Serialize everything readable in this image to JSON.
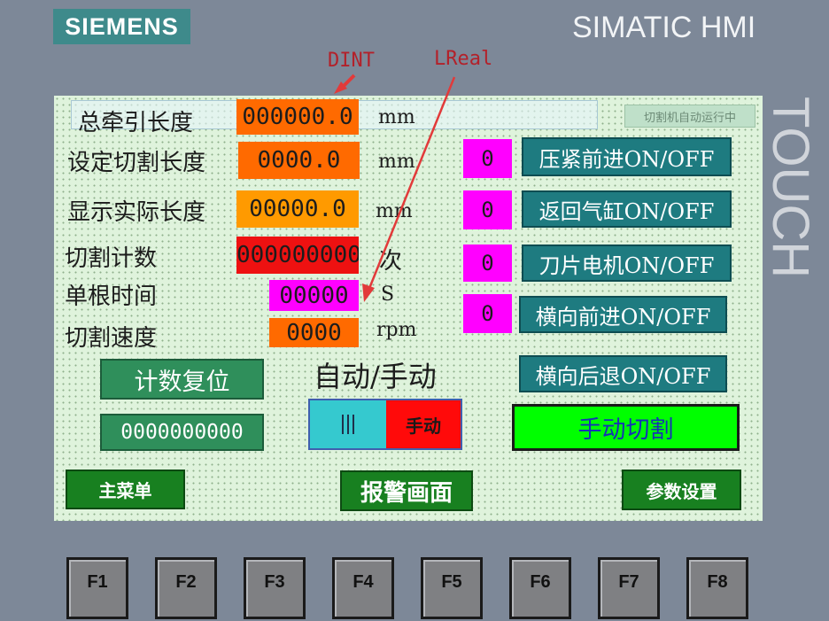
{
  "device": {
    "brand": "SIEMENS",
    "product": "SIMATIC HMI",
    "touch_label": "TOUCH"
  },
  "annotations": {
    "dint": "DINT",
    "lreal": "LReal",
    "arrow_color": "#e23a3a"
  },
  "status_banner": "切割机自动运行中",
  "rows": [
    {
      "label": "总牵引长度",
      "value": "000000.0",
      "unit": "mm",
      "color": "#ff6a00"
    },
    {
      "label": "设定切割长度",
      "value": "0000.0",
      "unit": "mm",
      "color": "#ff6a00"
    },
    {
      "label": "显示实际长度",
      "value": "00000.0",
      "unit": "mm",
      "color": "#ff9a00"
    },
    {
      "label": "切割计数",
      "value": "0000000000",
      "unit": "次",
      "color": "#ee1111"
    },
    {
      "label": "单根时间",
      "value": "00000",
      "unit": "S",
      "color": "#ff00ff"
    },
    {
      "label": "切割速度",
      "value": "0000",
      "unit": "rpm",
      "color": "#ff6a00"
    }
  ],
  "toggles": [
    {
      "indicator": "0",
      "label": "压紧前进ON/OFF"
    },
    {
      "indicator": "0",
      "label": "返回气缸ON/OFF"
    },
    {
      "indicator": "0",
      "label": "刀片电机ON/OFF"
    },
    {
      "indicator": "0",
      "label": "横向前进ON/OFF"
    },
    {
      "label": "横向后退ON/OFF"
    }
  ],
  "counter_reset_label": "计数复位",
  "counter_value": "0000000000",
  "mode": {
    "title": "自动/手动",
    "state": "手动"
  },
  "manual_cut_label": "手动切割",
  "nav": {
    "main_menu": "主菜单",
    "alarm_screen": "报警画面",
    "params": "参数设置"
  },
  "function_keys": [
    "F1",
    "F2",
    "F3",
    "F4",
    "F5",
    "F6",
    "F7",
    "F8"
  ]
}
